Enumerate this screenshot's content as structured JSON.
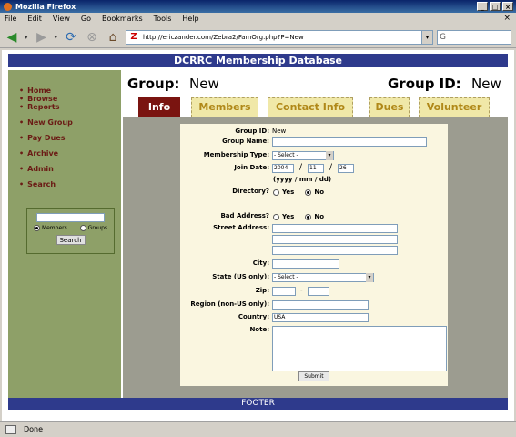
{
  "window": {
    "title": "Mozilla Firefox"
  },
  "menu": [
    "File",
    "Edit",
    "View",
    "Go",
    "Bookmarks",
    "Tools",
    "Help"
  ],
  "url": "http://ericzander.com/Zebra2/FamOrg.php?P=New",
  "page": {
    "banner": "DCRRC Membership Database",
    "group_label": "Group:",
    "group_value": "New",
    "group_id_label": "Group ID:",
    "group_id_value": "New",
    "footer": "FOOTER"
  },
  "sidebar": {
    "items": [
      "Home",
      "Browse",
      "Reports",
      "New Group",
      "Pay Dues",
      "Archive",
      "Admin",
      "Search"
    ],
    "radio_members": "Members",
    "radio_groups": "Groups",
    "search_button": "Search"
  },
  "tabs": [
    "Info",
    "Members",
    "Contact Info",
    "Dues",
    "Volunteer"
  ],
  "form": {
    "group_id_label": "Group ID:",
    "group_id_value": "New",
    "group_name_label": "Group Name:",
    "membership_type_label": "Membership Type:",
    "membership_type_value": "- Select -",
    "join_date_label": "Join Date:",
    "join_year": "2004",
    "join_month": "11",
    "join_day": "26",
    "date_format": "(yyyy / mm / dd)",
    "directory_label": "Directory?",
    "yes": "Yes",
    "no": "No",
    "bad_address_label": "Bad Address?",
    "street_label": "Street Address:",
    "city_label": "City:",
    "state_label": "State (US only):",
    "state_value": "- Select -",
    "zip_label": "Zip:",
    "zip_dash": "-",
    "region_label": "Region (non-US only):",
    "country_label": "Country:",
    "country_value": "USA",
    "note_label": "Note:",
    "submit": "Submit"
  },
  "status": "Done"
}
